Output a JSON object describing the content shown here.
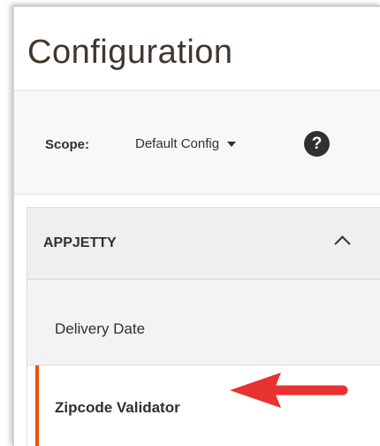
{
  "page": {
    "title": "Configuration"
  },
  "scope": {
    "label": "Scope:",
    "value": "Default Config",
    "help_glyph": "?"
  },
  "nav": {
    "section": "APPJETTY",
    "items": [
      {
        "label": "Delivery Date",
        "active": false
      },
      {
        "label": "Zipcode Validator",
        "active": true
      }
    ]
  },
  "colors": {
    "active_indicator": "#eb5202",
    "annotation_arrow": "#e8322f"
  }
}
